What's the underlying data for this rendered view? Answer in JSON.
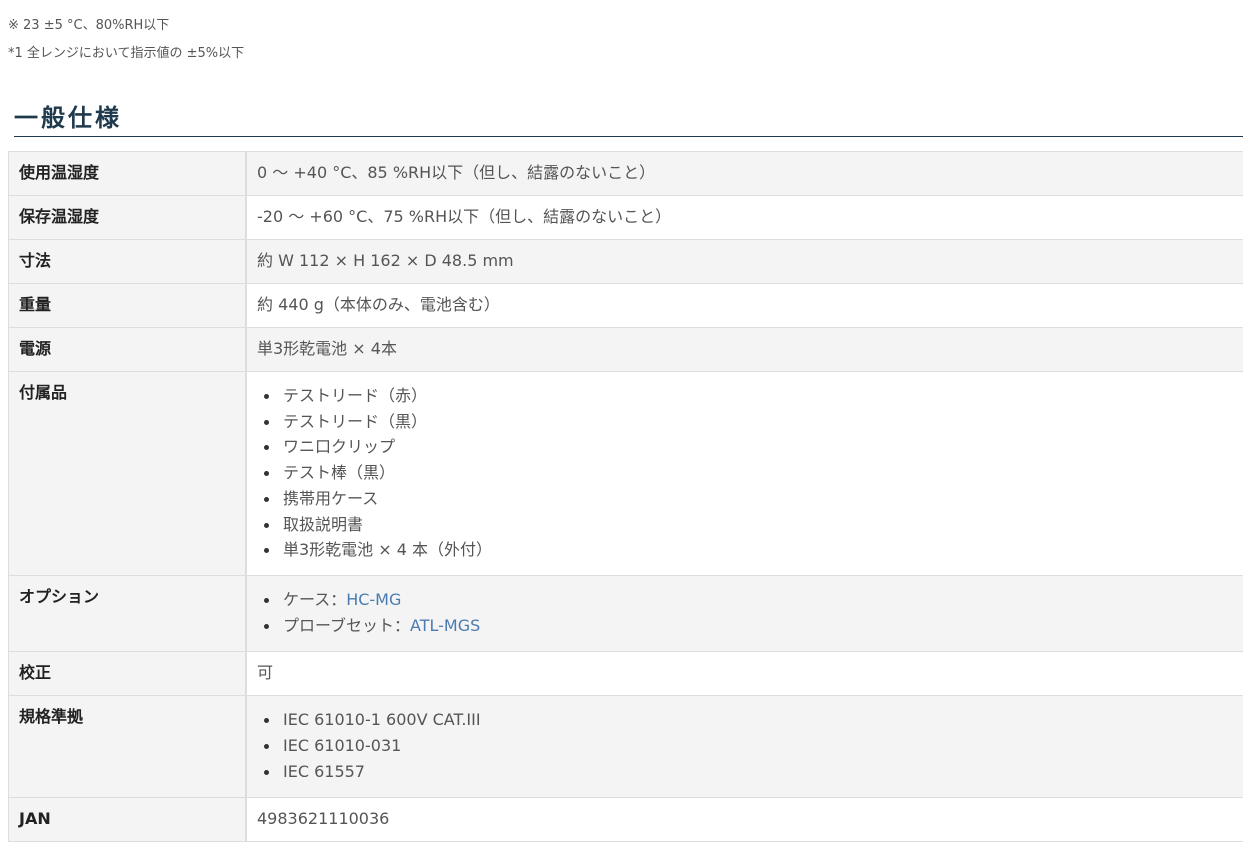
{
  "notes": [
    "※ 23 ±5 °C、80%RH以下",
    "*1 全レンジにおいて指示値の ±5%以下"
  ],
  "section_title": "一般仕様",
  "specs": {
    "operating_env": {
      "label": "使用温湿度",
      "value": "0 ～ +40 °C、85 %RH以下（但し、結露のないこと）"
    },
    "storage_env": {
      "label": "保存温湿度",
      "value": "-20 ～ +60 °C、75 %RH以下（但し、結露のないこと）"
    },
    "dimensions": {
      "label": "寸法",
      "value": "約 W 112 × H 162 × D 48.5 mm"
    },
    "weight": {
      "label": "重量",
      "value": "約 440 g（本体のみ、電池含む）"
    },
    "power": {
      "label": "電源",
      "value": "単3形乾電池 × 4本"
    },
    "accessories": {
      "label": "付属品",
      "items": [
        "テストリード（赤）",
        "テストリード（黒）",
        "ワニ口クリップ",
        "テスト棒（黒）",
        "携帯用ケース",
        "取扱説明書",
        "単3形乾電池 × 4 本（外付）"
      ]
    },
    "options": {
      "label": "オプション",
      "items": [
        {
          "prefix": "ケース：",
          "link": "HC-MG"
        },
        {
          "prefix": "プローブセット：",
          "link": "ATL-MGS"
        }
      ]
    },
    "calibration": {
      "label": "校正",
      "value": "可"
    },
    "standards": {
      "label": "規格準拠",
      "items": [
        "IEC 61010-1 600V CAT.III",
        "IEC 61010-031",
        "IEC 61557"
      ]
    },
    "jan": {
      "label": "JAN",
      "value": "4983621110036"
    }
  },
  "colors": {
    "title": "#1f3a4d",
    "link": "#4a7bb0",
    "header_bg": "#f4f4f4",
    "border": "#dddddd"
  }
}
